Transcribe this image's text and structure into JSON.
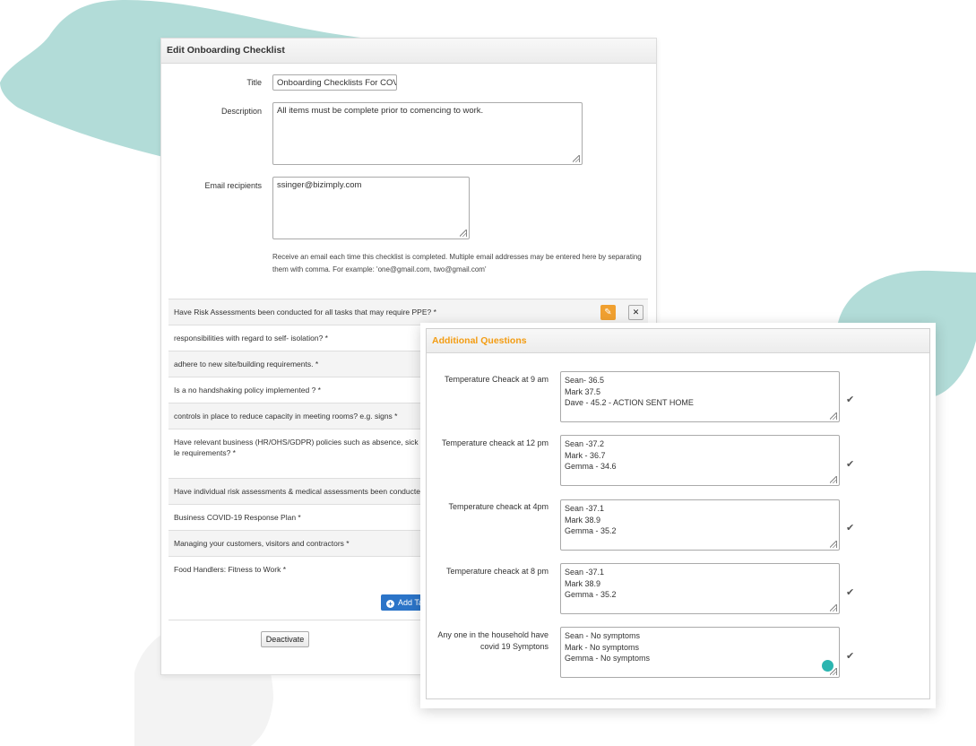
{
  "colors": {
    "blob": "#b2dcd8",
    "blob_grey": "#f3f3f3",
    "accent_orange": "#f39c12",
    "button_blue": "#2b74c8"
  },
  "main_panel": {
    "title": "Edit Onboarding Checklist",
    "title_label": "Title",
    "title_value": "Onboarding Checklists For COVI",
    "description_label": "Description",
    "description_value": "All items must be complete prior to comencing to work.",
    "email_label": "Email recipients",
    "email_value": "ssinger@bizimply.com",
    "email_help": "Receive an email each time this checklist is completed. Multiple email addresses may be entered here by separating them with comma. For example: 'one@gmail.com, two@gmail.com'",
    "questions": [
      "Have Risk Assessments been conducted for all tasks that may require PPE? *",
      "responsibilities with regard to self- isolation? *",
      "adhere to new site/building requirements. *",
      "Is a no handshaking policy implemented ? *",
      "controls in place to reduce capacity in meeting rooms? e.g. signs *",
      "Have relevant business (HR/OHS/GDPR) policies such as absence, sick le requirements? *",
      "Have individual risk assessments & medical assessments been conducte",
      "Business COVID-19 Response Plan *",
      "Managing your customers, visitors and contractors *",
      "Food Handlers: Fitness to Work *"
    ],
    "edit_icon": "pencil-icon",
    "delete_icon": "close-icon",
    "add_button": "Add Ta",
    "deactivate_button": "Deactivate"
  },
  "additional": {
    "title": "Additional Questions",
    "items": [
      {
        "label": "Temperature Cheack at 9 am",
        "lines": [
          "Sean- 36.5",
          "Mark 37.5",
          "Dave - 45.2 - ACTION SENT HOME"
        ]
      },
      {
        "label": "Temperature cheack at 12 pm",
        "lines": [
          "Sean -37.2",
          "Mark - 36.7",
          "Gemma - 34.6"
        ]
      },
      {
        "label": "Temperature cheack at 4pm",
        "lines": [
          "Sean -37.1",
          "Mark 38.9",
          "Gemma - 35.2"
        ]
      },
      {
        "label": "Temperature cheack at 8 pm",
        "lines": [
          "Sean -37.1",
          "Mark 38.9",
          "Gemma - 35.2"
        ]
      },
      {
        "label": "Any one in the household have covid 19 Symptons",
        "lines": [
          "Sean - No symptoms",
          "Mark - No symptoms",
          "Gemma - No symptoms"
        ]
      }
    ],
    "check_icon": "checkmark-icon",
    "check_glyph": "✔"
  }
}
